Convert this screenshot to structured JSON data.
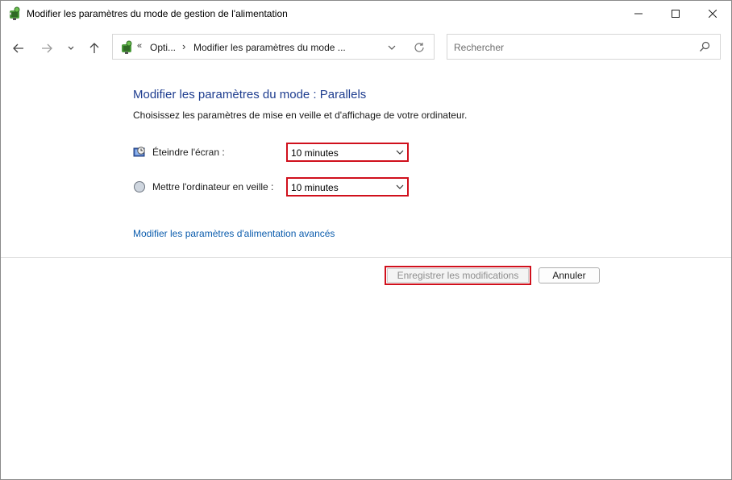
{
  "window": {
    "title": "Modifier les paramètres du mode de gestion de l'alimentation"
  },
  "address": {
    "overflow_chevron": "«",
    "segment1": "Opti...",
    "separator": "›",
    "segment2": "Modifier les paramètres du mode ..."
  },
  "search": {
    "placeholder": "Rechercher"
  },
  "content": {
    "heading": "Modifier les paramètres du mode : Parallels",
    "subtext": "Choisissez les paramètres de mise en veille et d'affichage de votre ordinateur.",
    "rows": [
      {
        "label": "Éteindre l'écran :",
        "value": "10 minutes",
        "icon": "display-clock-icon"
      },
      {
        "label": "Mettre l'ordinateur en veille :",
        "value": "10 minutes",
        "icon": "sleep-moon-icon"
      }
    ],
    "advanced_link": "Modifier les paramètres d'alimentation avancés"
  },
  "buttons": {
    "save": "Enregistrer les modifications",
    "cancel": "Annuler"
  },
  "colors": {
    "heading": "#1e3d8f",
    "link": "#0b5cad",
    "highlight": "#d0101c"
  }
}
